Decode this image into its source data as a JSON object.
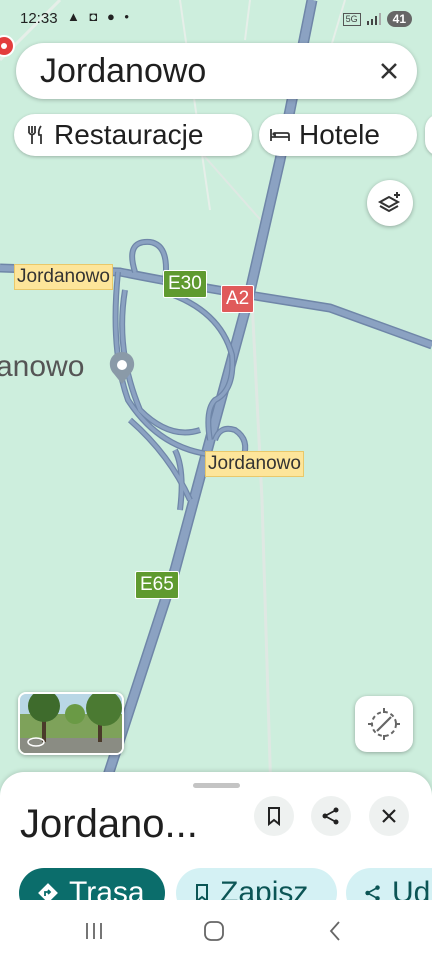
{
  "status_bar": {
    "time": "12:33",
    "icons_left": "▲ ◘ ●  •",
    "network_label": "5G",
    "battery": "41"
  },
  "search": {
    "query": "Jordanowo"
  },
  "chips": [
    {
      "label": "Restauracje",
      "icon": "fork-knife-icon"
    },
    {
      "label": "Hotele",
      "icon": "bed-icon"
    }
  ],
  "map": {
    "city_label": "anowo",
    "roads": {
      "e30": "E30",
      "a2": "A2",
      "e65": "E65"
    },
    "place_labels": [
      "Jordanowo",
      "Jordanowo"
    ],
    "colors": {
      "land": "#cdeedd",
      "highway": "#8ba2c2",
      "highway_edge": "#6f86a8"
    }
  },
  "sheet": {
    "title": "Jordano...",
    "actions": {
      "directions": "Trasa",
      "save": "Zapisz",
      "share": "Ud"
    },
    "colors": {
      "primary": "#0b6d6b",
      "secondary": "#d4f1f4"
    }
  }
}
